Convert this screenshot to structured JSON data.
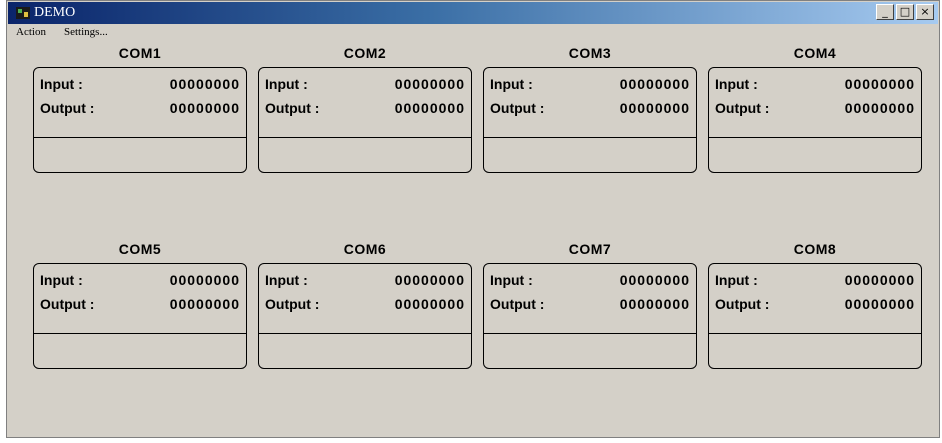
{
  "window": {
    "title": "DEMO",
    "controls": [
      "_",
      "□",
      "×"
    ]
  },
  "menu": [
    {
      "label": "Action"
    },
    {
      "label": "Settings..."
    }
  ],
  "ports": [
    {
      "name": "COM1",
      "input_label": "Input  :",
      "input_value": "00000000",
      "output_label": "Output :",
      "output_value": "00000000",
      "status": ""
    },
    {
      "name": "COM2",
      "input_label": "Input  :",
      "input_value": "00000000",
      "output_label": "Output :",
      "output_value": "00000000",
      "status": ""
    },
    {
      "name": "COM3",
      "input_label": "Input  :",
      "input_value": "00000000",
      "output_label": "Output :",
      "output_value": "00000000",
      "status": ""
    },
    {
      "name": "COM4",
      "input_label": "Input  :",
      "input_value": "00000000",
      "output_label": "Output :",
      "output_value": "00000000",
      "status": ""
    },
    {
      "name": "COM5",
      "input_label": "Input  :",
      "input_value": "00000000",
      "output_label": "Output :",
      "output_value": "00000000",
      "status": ""
    },
    {
      "name": "COM6",
      "input_label": "Input  :",
      "input_value": "00000000",
      "output_label": "Output :",
      "output_value": "00000000",
      "status": ""
    },
    {
      "name": "COM7",
      "input_label": "Input  :",
      "input_value": "00000000",
      "output_label": "Output :",
      "output_value": "00000000",
      "status": ""
    },
    {
      "name": "COM8",
      "input_label": "Input  :",
      "input_value": "00000000",
      "output_label": "Output :",
      "output_value": "00000000",
      "status": ""
    }
  ],
  "colors": {
    "title_start": "#0a246a",
    "title_end": "#a6caf0",
    "face": "#d4d0c8"
  }
}
